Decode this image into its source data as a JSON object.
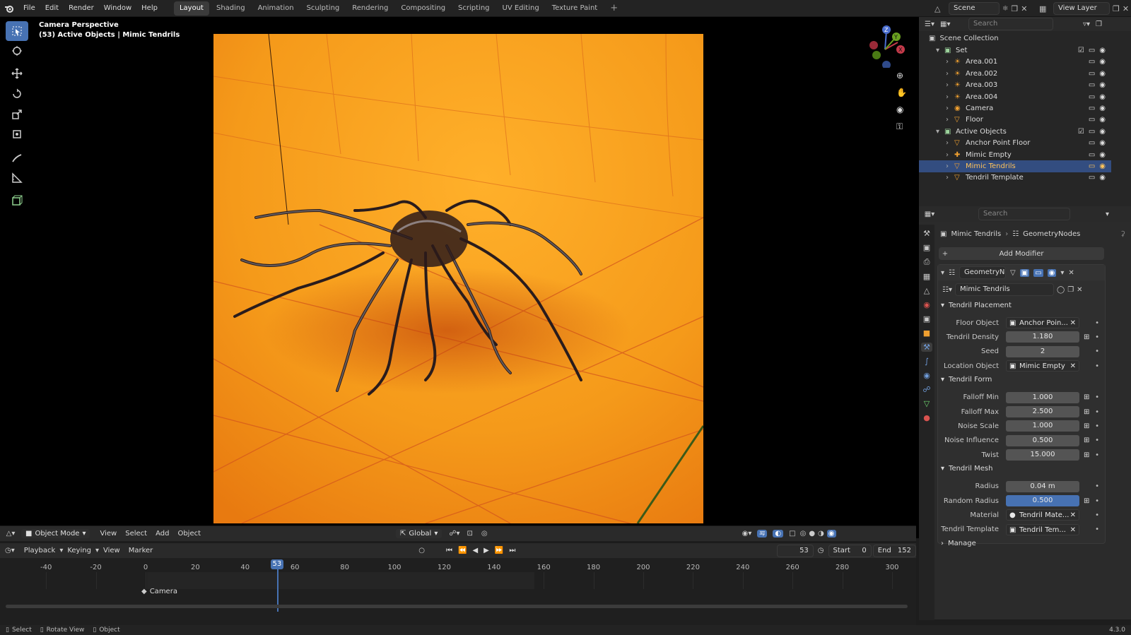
{
  "menu": [
    "File",
    "Edit",
    "Render",
    "Window",
    "Help"
  ],
  "workspaces": [
    "Layout",
    "Shading",
    "Animation",
    "Sculpting",
    "Rendering",
    "Compositing",
    "Scripting",
    "UV Editing",
    "Texture Paint"
  ],
  "active_workspace": "Layout",
  "scene_name": "Scene",
  "view_layer": "View Layer",
  "viewport": {
    "line1": "Camera Perspective",
    "line2": "(53) Active Objects | Mimic Tendrils"
  },
  "viewport_header": {
    "mode": "Object Mode",
    "menus": [
      "View",
      "Select",
      "Add",
      "Object"
    ],
    "transform": "Global"
  },
  "timeline_header": {
    "menus": [
      "Playback",
      "Keying",
      "View",
      "Marker"
    ],
    "current_frame": "53",
    "start_label": "Start",
    "start": "0",
    "end_label": "End",
    "end": "152"
  },
  "timeline": {
    "ticks": [
      "-40",
      "-20",
      "0",
      "20",
      "40",
      "60",
      "80",
      "100",
      "120",
      "140",
      "160",
      "180",
      "200",
      "220",
      "240",
      "260",
      "280",
      "300"
    ],
    "playhead": "53",
    "marker": "Camera"
  },
  "outliner": {
    "search_placeholder": "Search",
    "root": "Scene Collection",
    "rows": [
      {
        "label": "Set",
        "kind": "collection"
      },
      {
        "label": "Area.001",
        "kind": "light"
      },
      {
        "label": "Area.002",
        "kind": "light"
      },
      {
        "label": "Area.003",
        "kind": "light"
      },
      {
        "label": "Area.004",
        "kind": "light"
      },
      {
        "label": "Camera",
        "kind": "camera"
      },
      {
        "label": "Floor",
        "kind": "mesh"
      },
      {
        "label": "Active Objects",
        "kind": "collection"
      },
      {
        "label": "Anchor Point Floor",
        "kind": "mesh"
      },
      {
        "label": "Mimic Empty",
        "kind": "empty"
      },
      {
        "label": "Mimic Tendrils",
        "kind": "mesh"
      },
      {
        "label": "Tendril Template",
        "kind": "mesh"
      }
    ],
    "selected": "Mimic Tendrils"
  },
  "properties": {
    "search_placeholder": "Search",
    "breadcrumb_object": "Mimic Tendrils",
    "breadcrumb_modifier": "GeometryNodes",
    "add_modifier": "Add Modifier",
    "modifier_name": "GeometryNo...",
    "node_group": "Mimic Tendrils",
    "panels": [
      {
        "title": "Tendril Placement",
        "fields": [
          {
            "label": "Floor Object",
            "value": "Anchor Poin...",
            "type": "object"
          },
          {
            "label": "Tendril Density",
            "value": "1.180",
            "type": "number"
          },
          {
            "label": "Seed",
            "value": "2",
            "type": "number"
          },
          {
            "label": "Location Object",
            "value": "Mimic Empty",
            "type": "object"
          }
        ]
      },
      {
        "title": "Tendril Form",
        "fields": [
          {
            "label": "Falloff Min",
            "value": "1.000",
            "type": "number"
          },
          {
            "label": "Falloff Max",
            "value": "2.500",
            "type": "number"
          },
          {
            "label": "Noise Scale",
            "value": "1.000",
            "type": "number"
          },
          {
            "label": "Noise Influence",
            "value": "0.500",
            "type": "number"
          },
          {
            "label": "Twist",
            "value": "15.000",
            "type": "number"
          }
        ]
      },
      {
        "title": "Tendril Mesh",
        "fields": [
          {
            "label": "Radius",
            "value": "0.04 m",
            "type": "number"
          },
          {
            "label": "Random Radius",
            "value": "0.500",
            "type": "number-active"
          },
          {
            "label": "Material",
            "value": "Tendril Mate...",
            "type": "material"
          },
          {
            "label": "Tendril Template",
            "value": "Tendril Tem...",
            "type": "object"
          }
        ]
      }
    ],
    "manage": "Manage"
  },
  "statusbar": {
    "items": [
      "Select",
      "Rotate View",
      "Object"
    ],
    "version": "4.3.0"
  },
  "colors": {
    "accent": "#4772b3",
    "selected_text": "#ffc35a",
    "render_orange": "#f28c1e"
  }
}
